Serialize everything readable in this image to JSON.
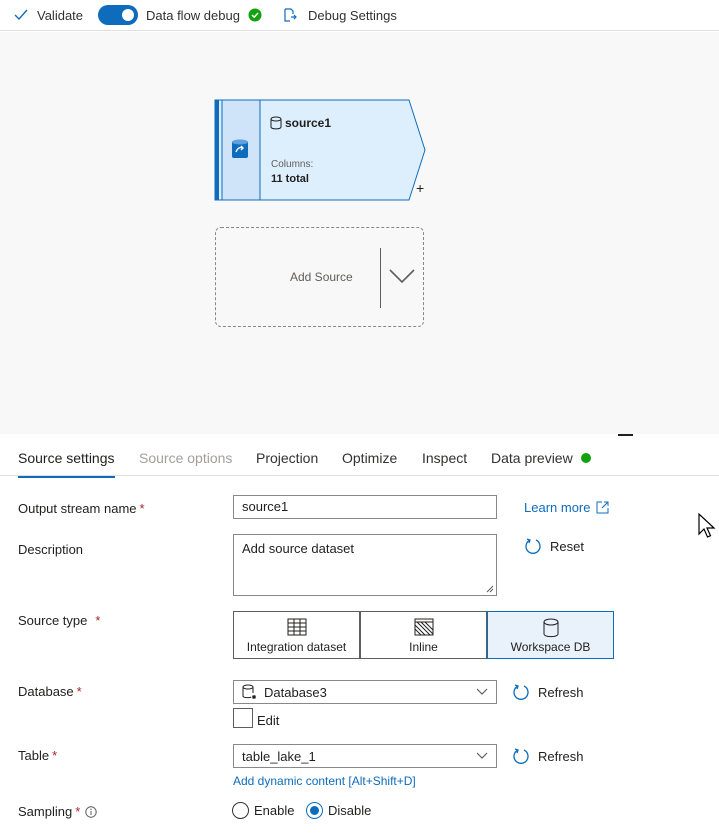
{
  "toolbar": {
    "validate_label": "Validate",
    "debug_label": "Data flow debug",
    "debug_on": true,
    "debug_settings_label": "Debug Settings"
  },
  "canvas": {
    "node": {
      "title": "source1",
      "columns_label": "Columns:",
      "columns_value": "11 total",
      "plus": "+"
    },
    "add_source": {
      "label": "Add Source"
    }
  },
  "tabs": [
    {
      "label": "Source settings",
      "state": "active"
    },
    {
      "label": "Source options",
      "state": "disabled"
    },
    {
      "label": "Projection",
      "state": "normal"
    },
    {
      "label": "Optimize",
      "state": "normal"
    },
    {
      "label": "Inspect",
      "state": "normal"
    },
    {
      "label": "Data preview",
      "state": "normal",
      "status_color": "#13a10e"
    }
  ],
  "form": {
    "output_stream": {
      "label": "Output stream name",
      "required": "*",
      "value": "source1",
      "learn_more": "Learn more"
    },
    "description": {
      "label": "Description",
      "value": "Add source dataset",
      "reset": "Reset"
    },
    "source_type": {
      "label": "Source type",
      "required": "*",
      "options": [
        "Integration dataset",
        "Inline",
        "Workspace DB"
      ],
      "selected": "Workspace DB"
    },
    "database": {
      "label": "Database",
      "required": "*",
      "value": "Database3",
      "refresh": "Refresh",
      "edit_label": "Edit",
      "edit_checked": false
    },
    "table": {
      "label": "Table",
      "required": "*",
      "value": "table_lake_1",
      "refresh": "Refresh",
      "dynamic_link": "Add dynamic content [Alt+Shift+D]"
    },
    "sampling": {
      "label": "Sampling",
      "required": "*",
      "enable": "Enable",
      "disable": "Disable",
      "selected": "Disable"
    }
  },
  "colors": {
    "accent": "#0f6cbd",
    "success": "#13a10e",
    "required": "#a4262c"
  }
}
